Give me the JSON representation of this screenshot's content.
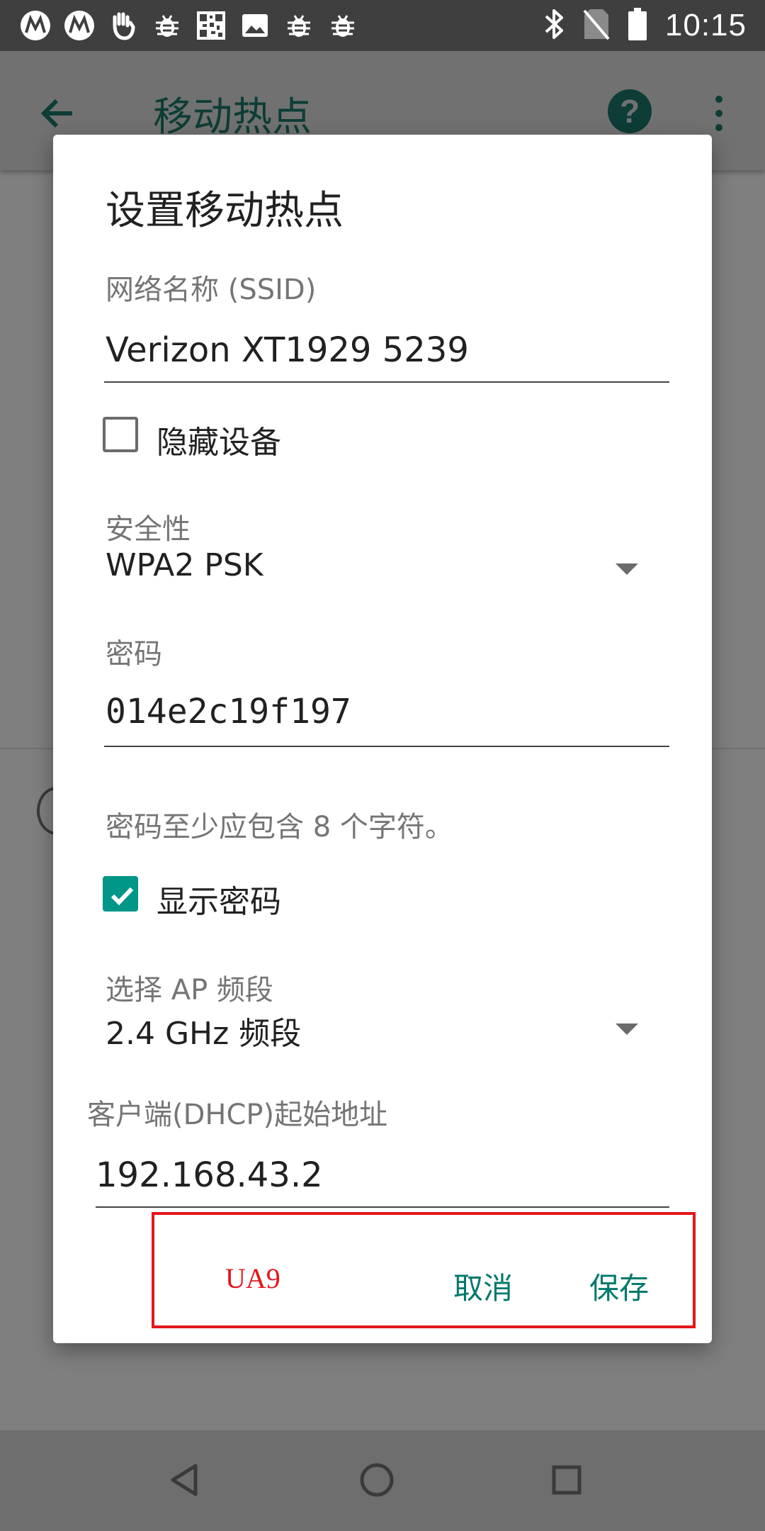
{
  "status_bar": {
    "time": "10:15",
    "left_icons": [
      "motorola-icon",
      "motorola-icon",
      "hand-icon",
      "bug-icon",
      "qr-code-icon",
      "image-icon",
      "bug-icon",
      "bug-icon"
    ],
    "right_icons": [
      "bluetooth-icon",
      "no-sim-icon",
      "battery-icon"
    ]
  },
  "app_bar": {
    "title": "移动热点",
    "back_icon": "arrow-back-icon",
    "help_icon": "help-icon",
    "help_glyph": "?",
    "more_icon": "more-vert-icon"
  },
  "dialog": {
    "title": "设置移动热点",
    "ssid": {
      "label": "网络名称 (SSID)",
      "value": "Verizon XT1929 5239"
    },
    "hide_device": {
      "label": "隐藏设备",
      "checked": false
    },
    "security": {
      "label": "安全性",
      "value": "WPA2 PSK"
    },
    "password": {
      "label": "密码",
      "value": "014e2c19f197",
      "helper": "密码至少应包含 8 个字符。"
    },
    "show_password": {
      "label": "显示密码",
      "checked": true
    },
    "ap_band": {
      "label": "选择 AP 频段",
      "value": "2.4 GHz 频段"
    },
    "dhcp": {
      "label": "客户端(DHCP)起始地址",
      "value": "192.168.43.2"
    },
    "actions": {
      "cancel": "取消",
      "save": "保存"
    },
    "annotation": {
      "label": "UA9",
      "color": "#e3151b"
    }
  },
  "nav_bar": {
    "back": "nav-back-icon",
    "home": "nav-home-icon",
    "recents": "nav-recents-icon"
  },
  "colors": {
    "accent": "#009688",
    "button_text": "#00796b",
    "scrim": "#7f7f7f"
  }
}
